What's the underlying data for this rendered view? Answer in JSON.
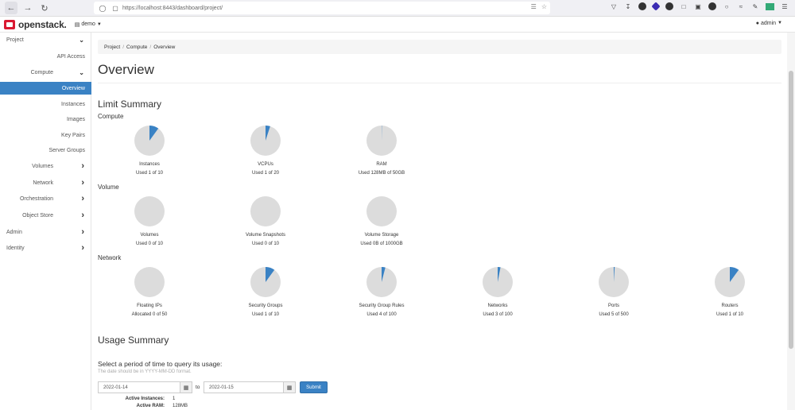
{
  "browser": {
    "url": "https://localhost:8443/dashboard/project/"
  },
  "header": {
    "logo_text": "openstack.",
    "project": "demo",
    "user": "admin"
  },
  "sidebar": {
    "items": [
      {
        "label": "Project",
        "level": 0,
        "chevron": "down"
      },
      {
        "label": "API Access",
        "level": 2
      },
      {
        "label": "Compute",
        "level": 1,
        "chevron": "down"
      },
      {
        "label": "Overview",
        "level": 2,
        "active": true
      },
      {
        "label": "Instances",
        "level": 2
      },
      {
        "label": "Images",
        "level": 2
      },
      {
        "label": "Key Pairs",
        "level": 2
      },
      {
        "label": "Server Groups",
        "level": 2
      },
      {
        "label": "Volumes",
        "level": 1,
        "chevron": "right"
      },
      {
        "label": "Network",
        "level": 1,
        "chevron": "right"
      },
      {
        "label": "Orchestration",
        "level": 1,
        "chevron": "right"
      },
      {
        "label": "Object Store",
        "level": 1,
        "chevron": "right"
      },
      {
        "label": "Admin",
        "level": 0,
        "chevron": "right"
      },
      {
        "label": "Identity",
        "level": 0,
        "chevron": "right"
      }
    ]
  },
  "breadcrumb": [
    "Project",
    "Compute",
    "Overview"
  ],
  "page_title": "Overview",
  "limit_summary": {
    "title": "Limit Summary",
    "sections": [
      {
        "title": "Compute",
        "charts": [
          {
            "label": "Instances",
            "used_text": "Used 1 of 10",
            "fraction": 0.1
          },
          {
            "label": "VCPUs",
            "used_text": "Used 1 of 20",
            "fraction": 0.05
          },
          {
            "label": "RAM",
            "used_text": "Used 128MB of 50GB",
            "fraction": 0.0025
          }
        ]
      },
      {
        "title": "Volume",
        "charts": [
          {
            "label": "Volumes",
            "used_text": "Used 0 of 10",
            "fraction": 0
          },
          {
            "label": "Volume Snapshots",
            "used_text": "Used 0 of 10",
            "fraction": 0
          },
          {
            "label": "Volume Storage",
            "used_text": "Used 0B of 1000GB",
            "fraction": 0
          }
        ]
      },
      {
        "title": "Network",
        "charts": [
          {
            "label": "Floating IPs",
            "used_text": "Allocated 0 of 50",
            "fraction": 0
          },
          {
            "label": "Security Groups",
            "used_text": "Used 1 of 10",
            "fraction": 0.1
          },
          {
            "label": "Security Group Rules",
            "used_text": "Used 4 of 100",
            "fraction": 0.04
          },
          {
            "label": "Networks",
            "used_text": "Used 3 of 100",
            "fraction": 0.03
          },
          {
            "label": "Ports",
            "used_text": "Used 5 of 500",
            "fraction": 0.01
          },
          {
            "label": "Routers",
            "used_text": "Used 1 of 10",
            "fraction": 0.1
          }
        ]
      }
    ]
  },
  "usage_summary": {
    "title": "Usage Summary",
    "prompt": "Select a period of time to query its usage:",
    "hint": "The date should be in YYYY-MM-DD format.",
    "start_date": "2022-01-14",
    "to_label": "to",
    "end_date": "2022-01-15",
    "submit_label": "Submit",
    "stats": [
      {
        "key": "Active Instances:",
        "value": "1"
      },
      {
        "key": "Active RAM:",
        "value": "128MB"
      }
    ]
  },
  "colors": {
    "accent": "#3a82c4",
    "pie_empty": "#dcdcdc",
    "pie_used": "#3a82c4"
  }
}
